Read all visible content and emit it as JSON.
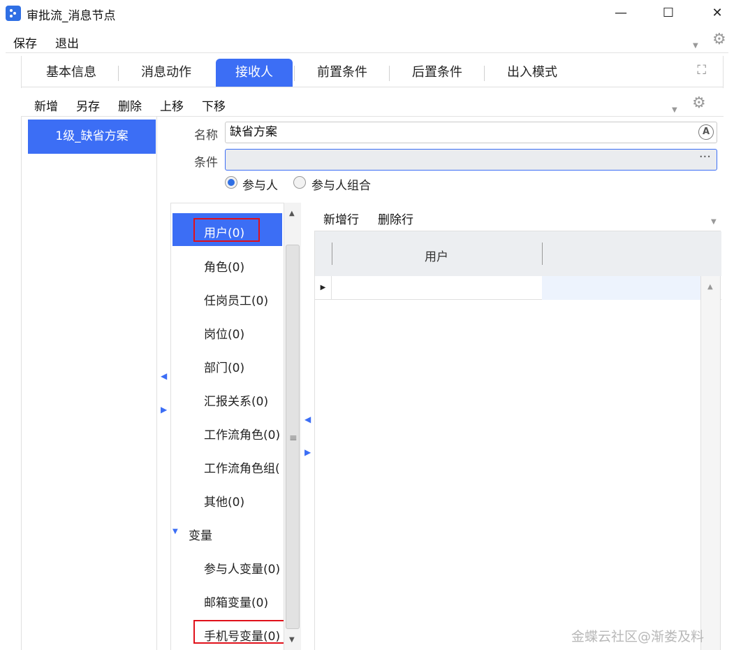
{
  "window": {
    "title": "审批流_消息节点",
    "minimize_symbol": "—",
    "maximize_symbol": "☐",
    "close_symbol": "✕"
  },
  "menu": {
    "save": "保存",
    "exit": "退出"
  },
  "tabs": [
    {
      "label": "基本信息"
    },
    {
      "label": "消息动作"
    },
    {
      "label": "接收人",
      "active": true
    },
    {
      "label": "前置条件"
    },
    {
      "label": "后置条件"
    },
    {
      "label": "出入模式"
    }
  ],
  "toolbar": {
    "add": "新增",
    "save_as": "另存",
    "delete": "删除",
    "move_up": "上移",
    "move_down": "下移"
  },
  "schemes": [
    {
      "label": "1级_缺省方案",
      "selected": true
    }
  ],
  "form": {
    "name_label": "名称",
    "name_value": "缺省方案",
    "condition_label": "条件",
    "condition_value": "",
    "condition_button": "···",
    "radio_participant": "参与人",
    "radio_participant_group": "参与人组合",
    "selected_radio": "参与人"
  },
  "tree": {
    "items": [
      {
        "label": "用户(0)",
        "selected": true,
        "highlighted": true
      },
      {
        "label": "角色(0)"
      },
      {
        "label": "任岗员工(0)"
      },
      {
        "label": "岗位(0)"
      },
      {
        "label": "部门(0)"
      },
      {
        "label": "汇报关系(0)"
      },
      {
        "label": "工作流角色(0)"
      },
      {
        "label": "工作流角色组("
      },
      {
        "label": "其他(0)"
      }
    ],
    "group": {
      "label": "变量",
      "expanded": true
    },
    "group_items": [
      {
        "label": "参与人变量(0)"
      },
      {
        "label": "邮箱变量(0)"
      },
      {
        "label": "手机号变量(0)",
        "highlighted": true
      }
    ]
  },
  "grid": {
    "add_row": "新增行",
    "delete_row": "删除行",
    "columns": [
      "用户"
    ],
    "rows": [
      {
        "用户": ""
      }
    ]
  },
  "watermark": "金蝶云社区@渐娄及料",
  "colors": {
    "accent": "#3c6ef5",
    "highlight_box": "#e0101a"
  }
}
